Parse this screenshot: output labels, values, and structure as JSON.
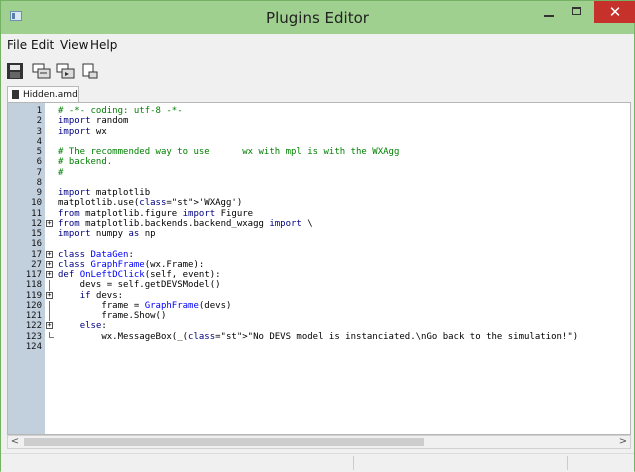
{
  "window": {
    "title": "Plugins Editor",
    "close_glyph": "✕"
  },
  "menu": [
    "File",
    "Edit",
    "View",
    "Help"
  ],
  "toolbar": {
    "icons": [
      "save-icon",
      "tool-icon",
      "tool-icon",
      "tool-icon"
    ]
  },
  "tab": {
    "label": "Hidden.amd"
  },
  "editor": {
    "lines": [
      {
        "n": "1",
        "t": "# -*- coding: utf-8 -*-"
      },
      {
        "n": "2",
        "t": "import random"
      },
      {
        "n": "3",
        "t": "import wx"
      },
      {
        "n": "4",
        "t": ""
      },
      {
        "n": "5",
        "t": "# The recommended way to use      wx with mpl is with the WXAgg"
      },
      {
        "n": "6",
        "t": "# backend."
      },
      {
        "n": "7",
        "t": "#"
      },
      {
        "n": "8",
        "t": ""
      },
      {
        "n": "9",
        "t": "import matplotlib"
      },
      {
        "n": "10",
        "t": "matplotlib.use('WXAgg')"
      },
      {
        "n": "11",
        "t": "from matplotlib.figure import Figure"
      },
      {
        "n": "12",
        "t": "from matplotlib.backends.backend_wxagg import \\"
      },
      {
        "n": "15",
        "t": "import numpy as np"
      },
      {
        "n": "16",
        "t": ""
      },
      {
        "n": "17",
        "t": "class DataGen:"
      },
      {
        "n": "27",
        "t": "class GraphFrame(wx.Frame):"
      },
      {
        "n": "117",
        "t": "def OnLeftDClick(self, event):"
      },
      {
        "n": "118",
        "t": "    devs = self.getDEVSModel()"
      },
      {
        "n": "119",
        "t": "    if devs:"
      },
      {
        "n": "120",
        "t": "        frame = GraphFrame(devs)"
      },
      {
        "n": "121",
        "t": "        frame.Show()"
      },
      {
        "n": "122",
        "t": "    else:"
      },
      {
        "n": "123",
        "t": "        wx.MessageBox(_(\"No DEVS model is instanciated.\\nGo back to the simulation!\")"
      },
      {
        "n": "124",
        "t": ""
      }
    ]
  },
  "scroll": {
    "left": "<",
    "right": ">"
  }
}
